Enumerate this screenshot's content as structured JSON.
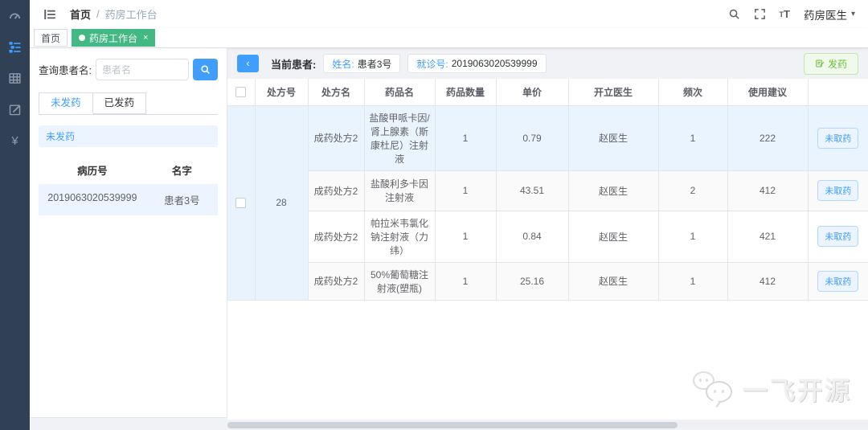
{
  "navbar": {
    "breadcrumb": {
      "home": "首页",
      "separator": "/",
      "current": "药房工作台"
    },
    "user": {
      "name": "药房医生"
    }
  },
  "tags_view": {
    "tabs": [
      {
        "label": "首页",
        "active": false
      },
      {
        "label": "药房工作台",
        "active": true,
        "close": "×"
      }
    ]
  },
  "left_panel": {
    "search": {
      "label": "查询患者名:",
      "placeholder": "患者名"
    },
    "tabs": [
      {
        "label": "未发药",
        "active": true
      },
      {
        "label": "已发药",
        "active": false
      }
    ],
    "status_banner": "未发药",
    "patients": {
      "headers": [
        "病历号",
        "名字"
      ],
      "rows": [
        {
          "record_no": "2019063020539999",
          "name": "患者3号",
          "selected": true
        }
      ]
    }
  },
  "patient_bar": {
    "back_button": "‹",
    "current_patient_label": "当前患者:",
    "name_label": "姓名:",
    "name_value": "患者3号",
    "visit_label": "就诊号:",
    "visit_value": "2019063020539999",
    "dispense_button": "发药"
  },
  "rx_table": {
    "headers": [
      "处方号",
      "处方名",
      "药品名",
      "药品数量",
      "单价",
      "开立医生",
      "频次",
      "使用建议",
      ""
    ],
    "group": {
      "prescription_no": "28"
    },
    "rows": [
      {
        "prescription_name": "成药处方2",
        "drug_name": "盐酸甲哌卡因/肾上腺素（斯康杜尼）注射液",
        "quantity": "1",
        "unit_price": "0.79",
        "doctor": "赵医生",
        "frequency": "1",
        "usage_advice": "222",
        "action": "未取药",
        "highlighted": true
      },
      {
        "prescription_name": "成药处方2",
        "drug_name": "盐酸利多卡因注射液",
        "quantity": "1",
        "unit_price": "43.51",
        "doctor": "赵医生",
        "frequency": "2",
        "usage_advice": "412",
        "action": "未取药",
        "highlighted": false
      },
      {
        "prescription_name": "成药处方2",
        "drug_name": "帕拉米韦氯化钠注射液（力纬）",
        "quantity": "1",
        "unit_price": "0.84",
        "doctor": "赵医生",
        "frequency": "1",
        "usage_advice": "421",
        "action": "未取药",
        "highlighted": false
      },
      {
        "prescription_name": "成药处方2",
        "drug_name": "50%葡萄糖注射液(塑瓶)",
        "quantity": "1",
        "unit_price": "25.16",
        "doctor": "赵医生",
        "frequency": "1",
        "usage_advice": "412",
        "action": "未取药",
        "highlighted": false
      }
    ]
  },
  "watermark": {
    "text": "一飞开源"
  },
  "colors": {
    "primary": "#409eff",
    "tag_active": "#42b983",
    "sidebar_bg": "#304156",
    "row_highlight": "#eaf4fe",
    "success_text": "#67c23a"
  }
}
